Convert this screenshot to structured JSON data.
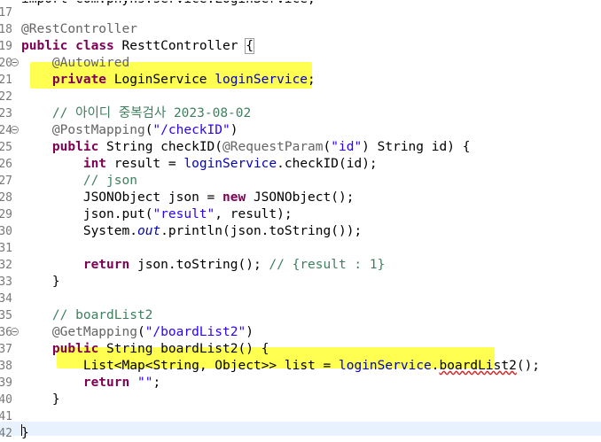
{
  "editor": {
    "top_partial_line": "import com.phyns.service.LoginService;",
    "lines": [
      {
        "num": "17",
        "fold": false,
        "code": ""
      },
      {
        "num": "18",
        "fold": false,
        "code": "@RestController"
      },
      {
        "num": "19",
        "fold": false,
        "code": "public class ResttController {"
      },
      {
        "num": "20",
        "fold": true,
        "code": "    @Autowired"
      },
      {
        "num": "21",
        "fold": false,
        "code": "    private LoginService loginService;"
      },
      {
        "num": "22",
        "fold": false,
        "code": ""
      },
      {
        "num": "23",
        "fold": false,
        "code": "    // 아이디 중복검사 2023-08-02"
      },
      {
        "num": "24",
        "fold": true,
        "code": "    @PostMapping(\"/checkID\")"
      },
      {
        "num": "25",
        "fold": false,
        "code": "    public String checkID(@RequestParam(\"id\") String id) {"
      },
      {
        "num": "26",
        "fold": false,
        "code": "        int result = loginService.checkID(id);"
      },
      {
        "num": "27",
        "fold": false,
        "code": "        // json"
      },
      {
        "num": "28",
        "fold": false,
        "code": "        JSONObject json = new JSONObject();"
      },
      {
        "num": "29",
        "fold": false,
        "code": "        json.put(\"result\", result);"
      },
      {
        "num": "30",
        "fold": false,
        "code": "        System.out.println(json.toString());"
      },
      {
        "num": "31",
        "fold": false,
        "code": ""
      },
      {
        "num": "32",
        "fold": false,
        "code": "        return json.toString(); // {result : 1}"
      },
      {
        "num": "33",
        "fold": false,
        "code": "    }"
      },
      {
        "num": "34",
        "fold": false,
        "code": ""
      },
      {
        "num": "35",
        "fold": false,
        "code": "    // boardList2"
      },
      {
        "num": "36",
        "fold": true,
        "code": "    @GetMapping(\"/boardList2\")"
      },
      {
        "num": "37",
        "fold": false,
        "code": "    public String boardList2() {"
      },
      {
        "num": "38",
        "fold": false,
        "code": "        List<Map<String, Object>> list = loginService.boardList2();"
      },
      {
        "num": "39",
        "fold": false,
        "code": "        return \"\";"
      },
      {
        "num": "40",
        "fold": false,
        "code": "    }"
      },
      {
        "num": "41",
        "fold": false,
        "code": ""
      },
      {
        "num": "42",
        "fold": false,
        "code": "}"
      }
    ],
    "colors": {
      "keyword": "#7f0055",
      "annotation": "#646464",
      "string": "#2a00ff",
      "comment": "#3f7f5f",
      "field": "#0000c0",
      "highlighter": "#ffff33",
      "current_line": "#e8f2fe"
    }
  }
}
